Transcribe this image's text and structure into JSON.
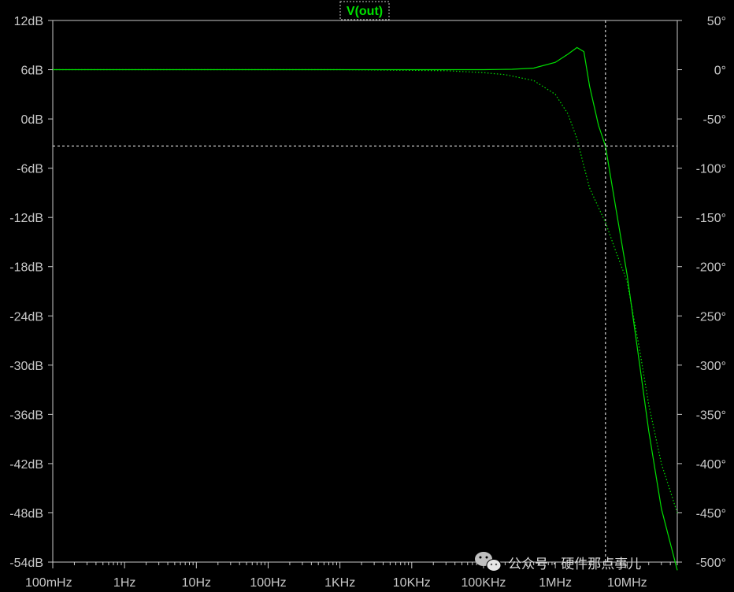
{
  "chart_data": {
    "type": "line",
    "title": "V(out)",
    "x_scale": "log",
    "x_ticks": [
      {
        "value": 0.1,
        "label": "100mHz"
      },
      {
        "value": 1,
        "label": "1Hz"
      },
      {
        "value": 10,
        "label": "10Hz"
      },
      {
        "value": 100,
        "label": "100Hz"
      },
      {
        "value": 1000,
        "label": "1KHz"
      },
      {
        "value": 10000,
        "label": "10KHz"
      },
      {
        "value": 100000,
        "label": "100KHz"
      },
      {
        "value": 1000000,
        "label": "1MHz"
      },
      {
        "value": 10000000,
        "label": "10MHz"
      }
    ],
    "xlim": [
      0.1,
      50000000
    ],
    "y_left": {
      "unit": "dB",
      "ylim": [
        -54,
        12
      ],
      "ticks": [
        {
          "value": 12,
          "label": "12dB"
        },
        {
          "value": 6,
          "label": "6dB"
        },
        {
          "value": 0,
          "label": "0dB"
        },
        {
          "value": -6,
          "label": "-6dB"
        },
        {
          "value": -12,
          "label": "-12dB"
        },
        {
          "value": -18,
          "label": "-18dB"
        },
        {
          "value": -24,
          "label": "-24dB"
        },
        {
          "value": -30,
          "label": "-30dB"
        },
        {
          "value": -36,
          "label": "-36dB"
        },
        {
          "value": -42,
          "label": "-42dB"
        },
        {
          "value": -48,
          "label": "-48dB"
        },
        {
          "value": -54,
          "label": "-54dB"
        }
      ]
    },
    "y_right": {
      "unit": "degrees",
      "ylim": [
        -500,
        50
      ],
      "ticks": [
        {
          "value": 50,
          "label": "50°"
        },
        {
          "value": 0,
          "label": "0°"
        },
        {
          "value": -50,
          "label": "-50°"
        },
        {
          "value": -100,
          "label": "-100°"
        },
        {
          "value": -150,
          "label": "-150°"
        },
        {
          "value": -200,
          "label": "-200°"
        },
        {
          "value": -250,
          "label": "-250°"
        },
        {
          "value": -300,
          "label": "-300°"
        },
        {
          "value": -350,
          "label": "-350°"
        },
        {
          "value": -400,
          "label": "-400°"
        },
        {
          "value": -450,
          "label": "-450°"
        },
        {
          "value": -500,
          "label": "-500°"
        }
      ]
    },
    "series": [
      {
        "name": "V(out)",
        "axis": "left",
        "style": "solid",
        "x": [
          0.1,
          10000,
          100000,
          250000,
          500000,
          1000000,
          1500000,
          2000000,
          2500000,
          3000000,
          4000000,
          5000000,
          7000000,
          10000000,
          15000000,
          20000000,
          30000000,
          50000000
        ],
        "y": [
          6.0,
          6.0,
          6.0,
          6.05,
          6.2,
          6.9,
          7.9,
          8.7,
          8.2,
          4.0,
          -0.8,
          -3.3,
          -11.0,
          -19.0,
          -30.0,
          -38.0,
          -47.5,
          -55.0
        ]
      },
      {
        "name": "",
        "axis": "right",
        "style": "dotted",
        "x": [
          0.1,
          1000,
          30000,
          100000,
          200000,
          500000,
          1000000,
          1500000,
          2000000,
          2500000,
          3000000,
          4000000,
          5000000,
          7000000,
          10000000,
          15000000,
          20000000,
          30000000,
          50000000
        ],
        "y": [
          0,
          0,
          -1,
          -3,
          -5,
          -11,
          -25,
          -45,
          -70,
          -98,
          -120,
          -140,
          -155,
          -185,
          -215,
          -285,
          -340,
          -400,
          -450
        ]
      }
    ],
    "cursors": {
      "x": 5000000,
      "y_db": -3.3
    },
    "grid": false
  },
  "watermark": {
    "text": "公众号 · 硬件那点事儿",
    "icon": "wechat-icon"
  },
  "colors": {
    "background": "#000000",
    "trace": "#00e000",
    "axis": "#c8c8c8",
    "cursor": "#ffffff"
  }
}
